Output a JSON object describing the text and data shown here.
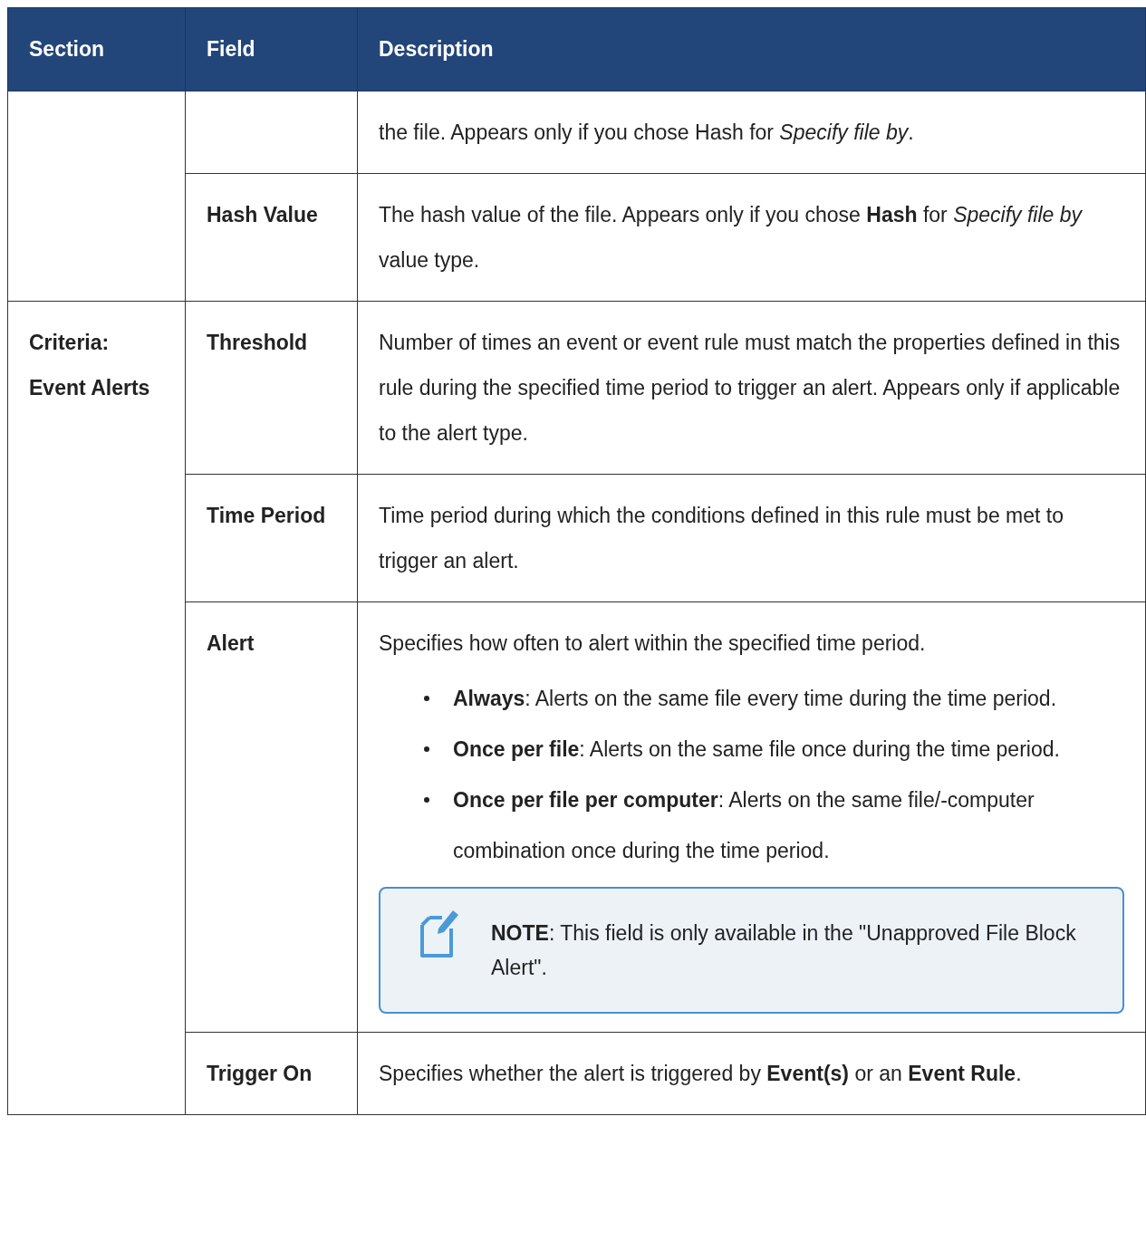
{
  "table": {
    "columns": [
      "Section",
      "Field",
      "Description"
    ],
    "groups": [
      {
        "rows": [
          {
            "blocks": [
              {
                "kind": "paragraph",
                "text": "the file. Appears only if you chose Hash for *Specify file by*."
              }
            ]
          },
          {
            "field": "Hash Value",
            "blocks": [
              {
                "kind": "paragraph",
                "text": "The hash value of the file. Appears only if you chose **Hash** for *Specify file by* value type."
              }
            ]
          }
        ]
      },
      {
        "section": "Criteria: Event Alerts",
        "rows": [
          {
            "field": "Threshold",
            "blocks": [
              {
                "kind": "paragraph",
                "text": "Number of times an event or event rule must match the properties defined in this rule during the specified time period to trigger an alert. Appears only if applicable to the alert type."
              }
            ]
          },
          {
            "field": "Time Period",
            "blocks": [
              {
                "kind": "paragraph",
                "text": "Time period during which the conditions defined in this rule must be met to trigger an alert."
              }
            ]
          },
          {
            "field": "Alert",
            "blocks": [
              {
                "kind": "paragraph",
                "text": "Specifies how often to alert within the specified time period."
              },
              {
                "kind": "bullets",
                "items": [
                  "**Always**: Alerts on the same file every time during the time period.",
                  "**Once per file**: Alerts on the same file once during the time period.",
                  "**Once per file per computer**: Alerts on the same file/-computer combination once during the time period."
                ]
              },
              {
                "kind": "note",
                "text": "**NOTE**: This field is only available in the \"Unapproved File Block Alert\"."
              }
            ]
          },
          {
            "field": "Trigger On",
            "blocks": [
              {
                "kind": "paragraph",
                "text": "Specifies whether the alert is triggered by **Event(s)** or an **Event Rule**."
              }
            ]
          }
        ]
      }
    ]
  }
}
